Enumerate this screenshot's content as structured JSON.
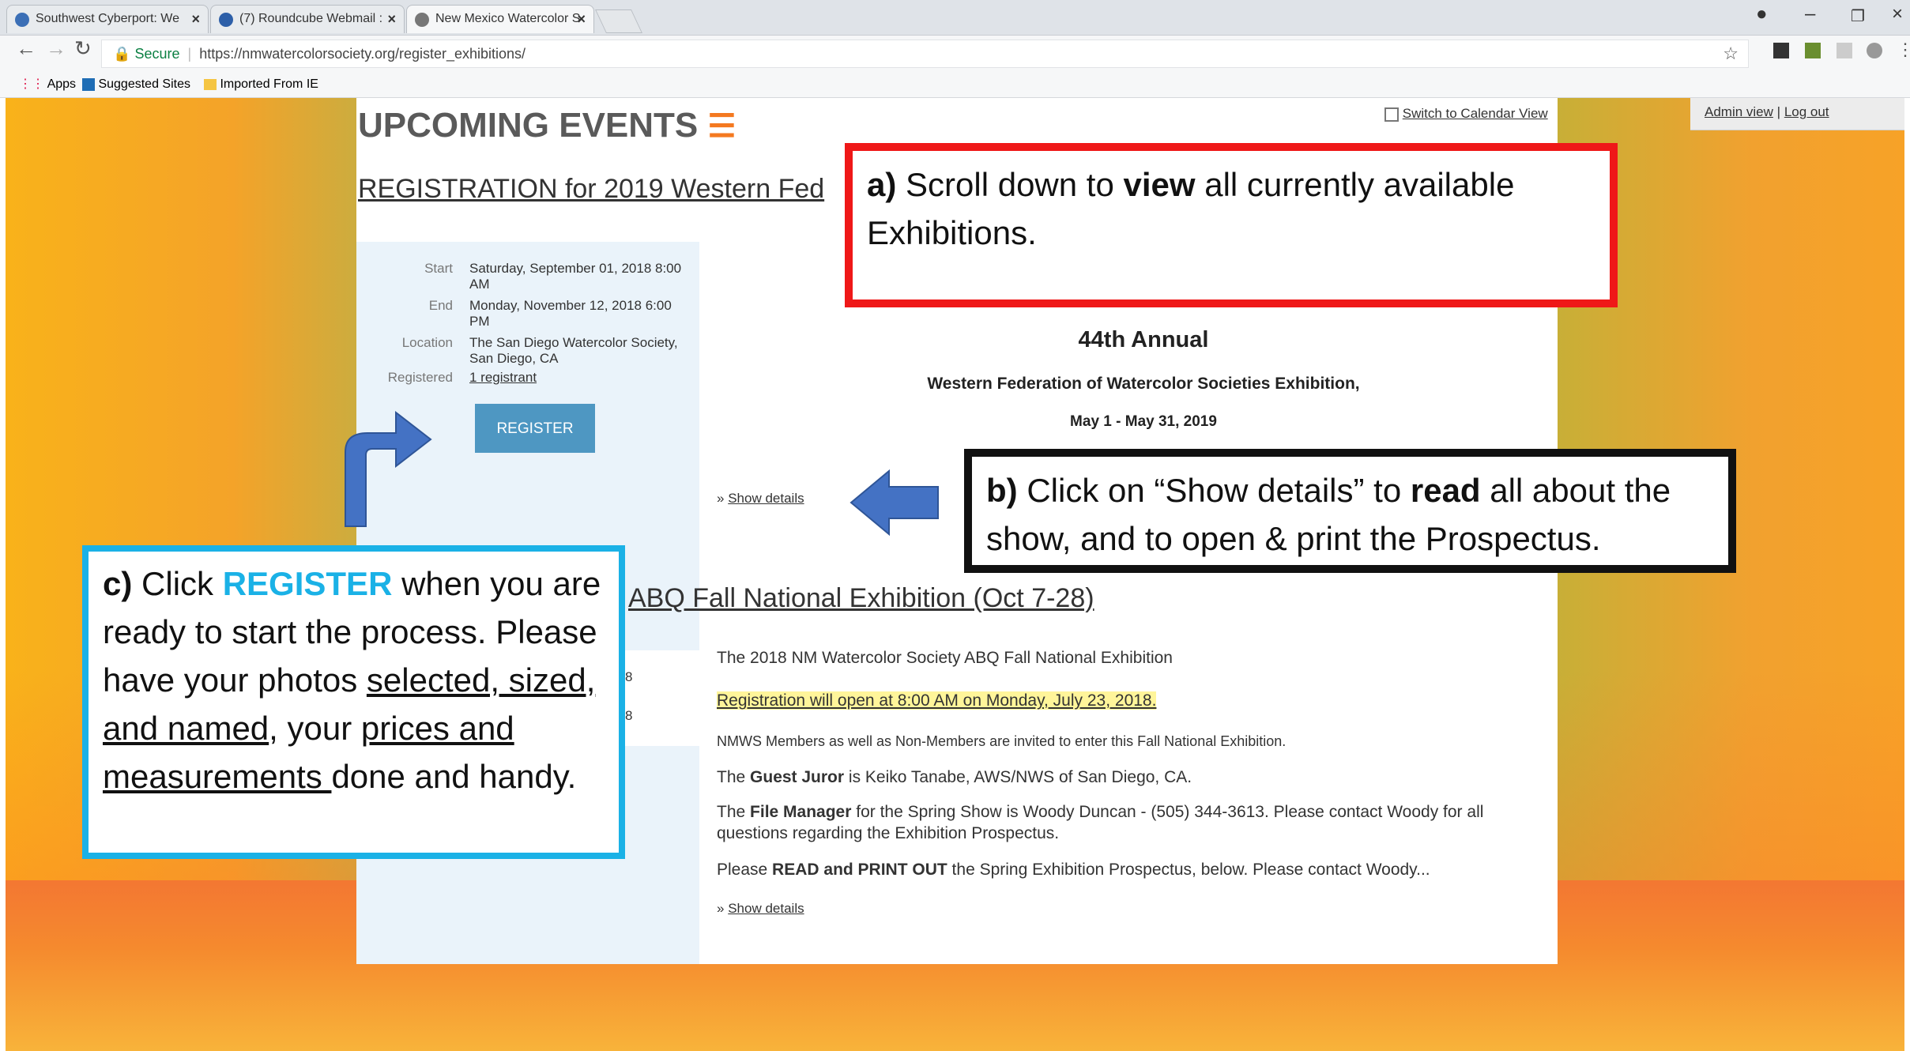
{
  "browser": {
    "tabs": [
      {
        "title": "Southwest Cyberport: We",
        "active": false
      },
      {
        "title": "(7) Roundcube Webmail :",
        "active": false
      },
      {
        "title": "New Mexico Watercolor S",
        "active": true
      }
    ],
    "address": {
      "secure_label": "Secure",
      "url": "https://nmwatercolorsociety.org/register_exhibitions/"
    },
    "bookmarks": [
      "Apps",
      "Suggested Sites",
      "Imported From IE"
    ]
  },
  "page": {
    "heading": "UPCOMING EVENTS",
    "calendar_link": "Switch to Calendar View",
    "admin": {
      "admin_view": "Admin view",
      "separator": "|",
      "logout": "Log out"
    },
    "event1": {
      "title": "REGISTRATION for 2019 Western Fed",
      "labels": {
        "start": "Start",
        "end": "End",
        "location": "Location",
        "registered": "Registered"
      },
      "start": "Saturday, September 01, 2018 8:00 AM",
      "end": "Monday, November 12, 2018 6:00 PM",
      "location": "The San Diego Watercolor Society, San Diego, CA",
      "registered": "1 registrant",
      "register_button": "REGISTER",
      "annual": "44th Annual",
      "exhibition": "Western Federation of Watercolor Societies Exhibition,",
      "dates": "May 1 - May 31, 2019",
      "show_details": "Show details"
    },
    "event2": {
      "title": "ABQ Fall National Exhibition (Oct 7-28)",
      "date_fragments": [
        "8",
        "8"
      ],
      "line1": "The 2018 NM Watercolor Society ABQ Fall National Exhibition",
      "registration_open": "Registration will open at 8:00 AM on Monday, July 23, 2018.",
      "members": "NMWS Members as well as Non-Members are invited to enter this Fall National Exhibition.",
      "juror_pre": "The ",
      "juror_bold": "Guest Juror",
      "juror_post": " is Keiko Tanabe, AWS/NWS of San Diego, CA.",
      "fm_pre": "The ",
      "fm_bold": "File Manager",
      "fm_post": " for the Spring Show is Woody Duncan - (505) 344-3613. Please contact Woody for all questions regarding the Exhibition Prospectus.",
      "read_pre": "Please ",
      "read_bold": "READ and PRINT OUT",
      "read_post": " the Spring Exhibition Prospectus, below. Please contact Woody...",
      "show_details": "Show details"
    }
  },
  "annotations": {
    "a": {
      "letter": "a)",
      "t1": " Scroll down to ",
      "bold": "view",
      "t2": " all currently available Exhibitions."
    },
    "b": {
      "letter": "b)",
      "t1": " Click on “Show details” to ",
      "bold": "read",
      "t2": " all about the show, and to open & print the Prospectus."
    },
    "c": {
      "letter": "c)",
      "t1": " Click ",
      "register": "REGISTER",
      "t2": " when you are ready to start the process. Please have your photos ",
      "u1": "selected, sized, and named",
      "t3": ", your ",
      "u2": "prices and  measurements ",
      "t4": "done and handy."
    }
  },
  "colors": {
    "annotation_a_border": "#ef1818",
    "annotation_b_border": "#111111",
    "annotation_c_border": "#1ab1e6",
    "register_button": "#4e97c2",
    "arrow": "#4472c4",
    "highlight": "#fff59a"
  }
}
